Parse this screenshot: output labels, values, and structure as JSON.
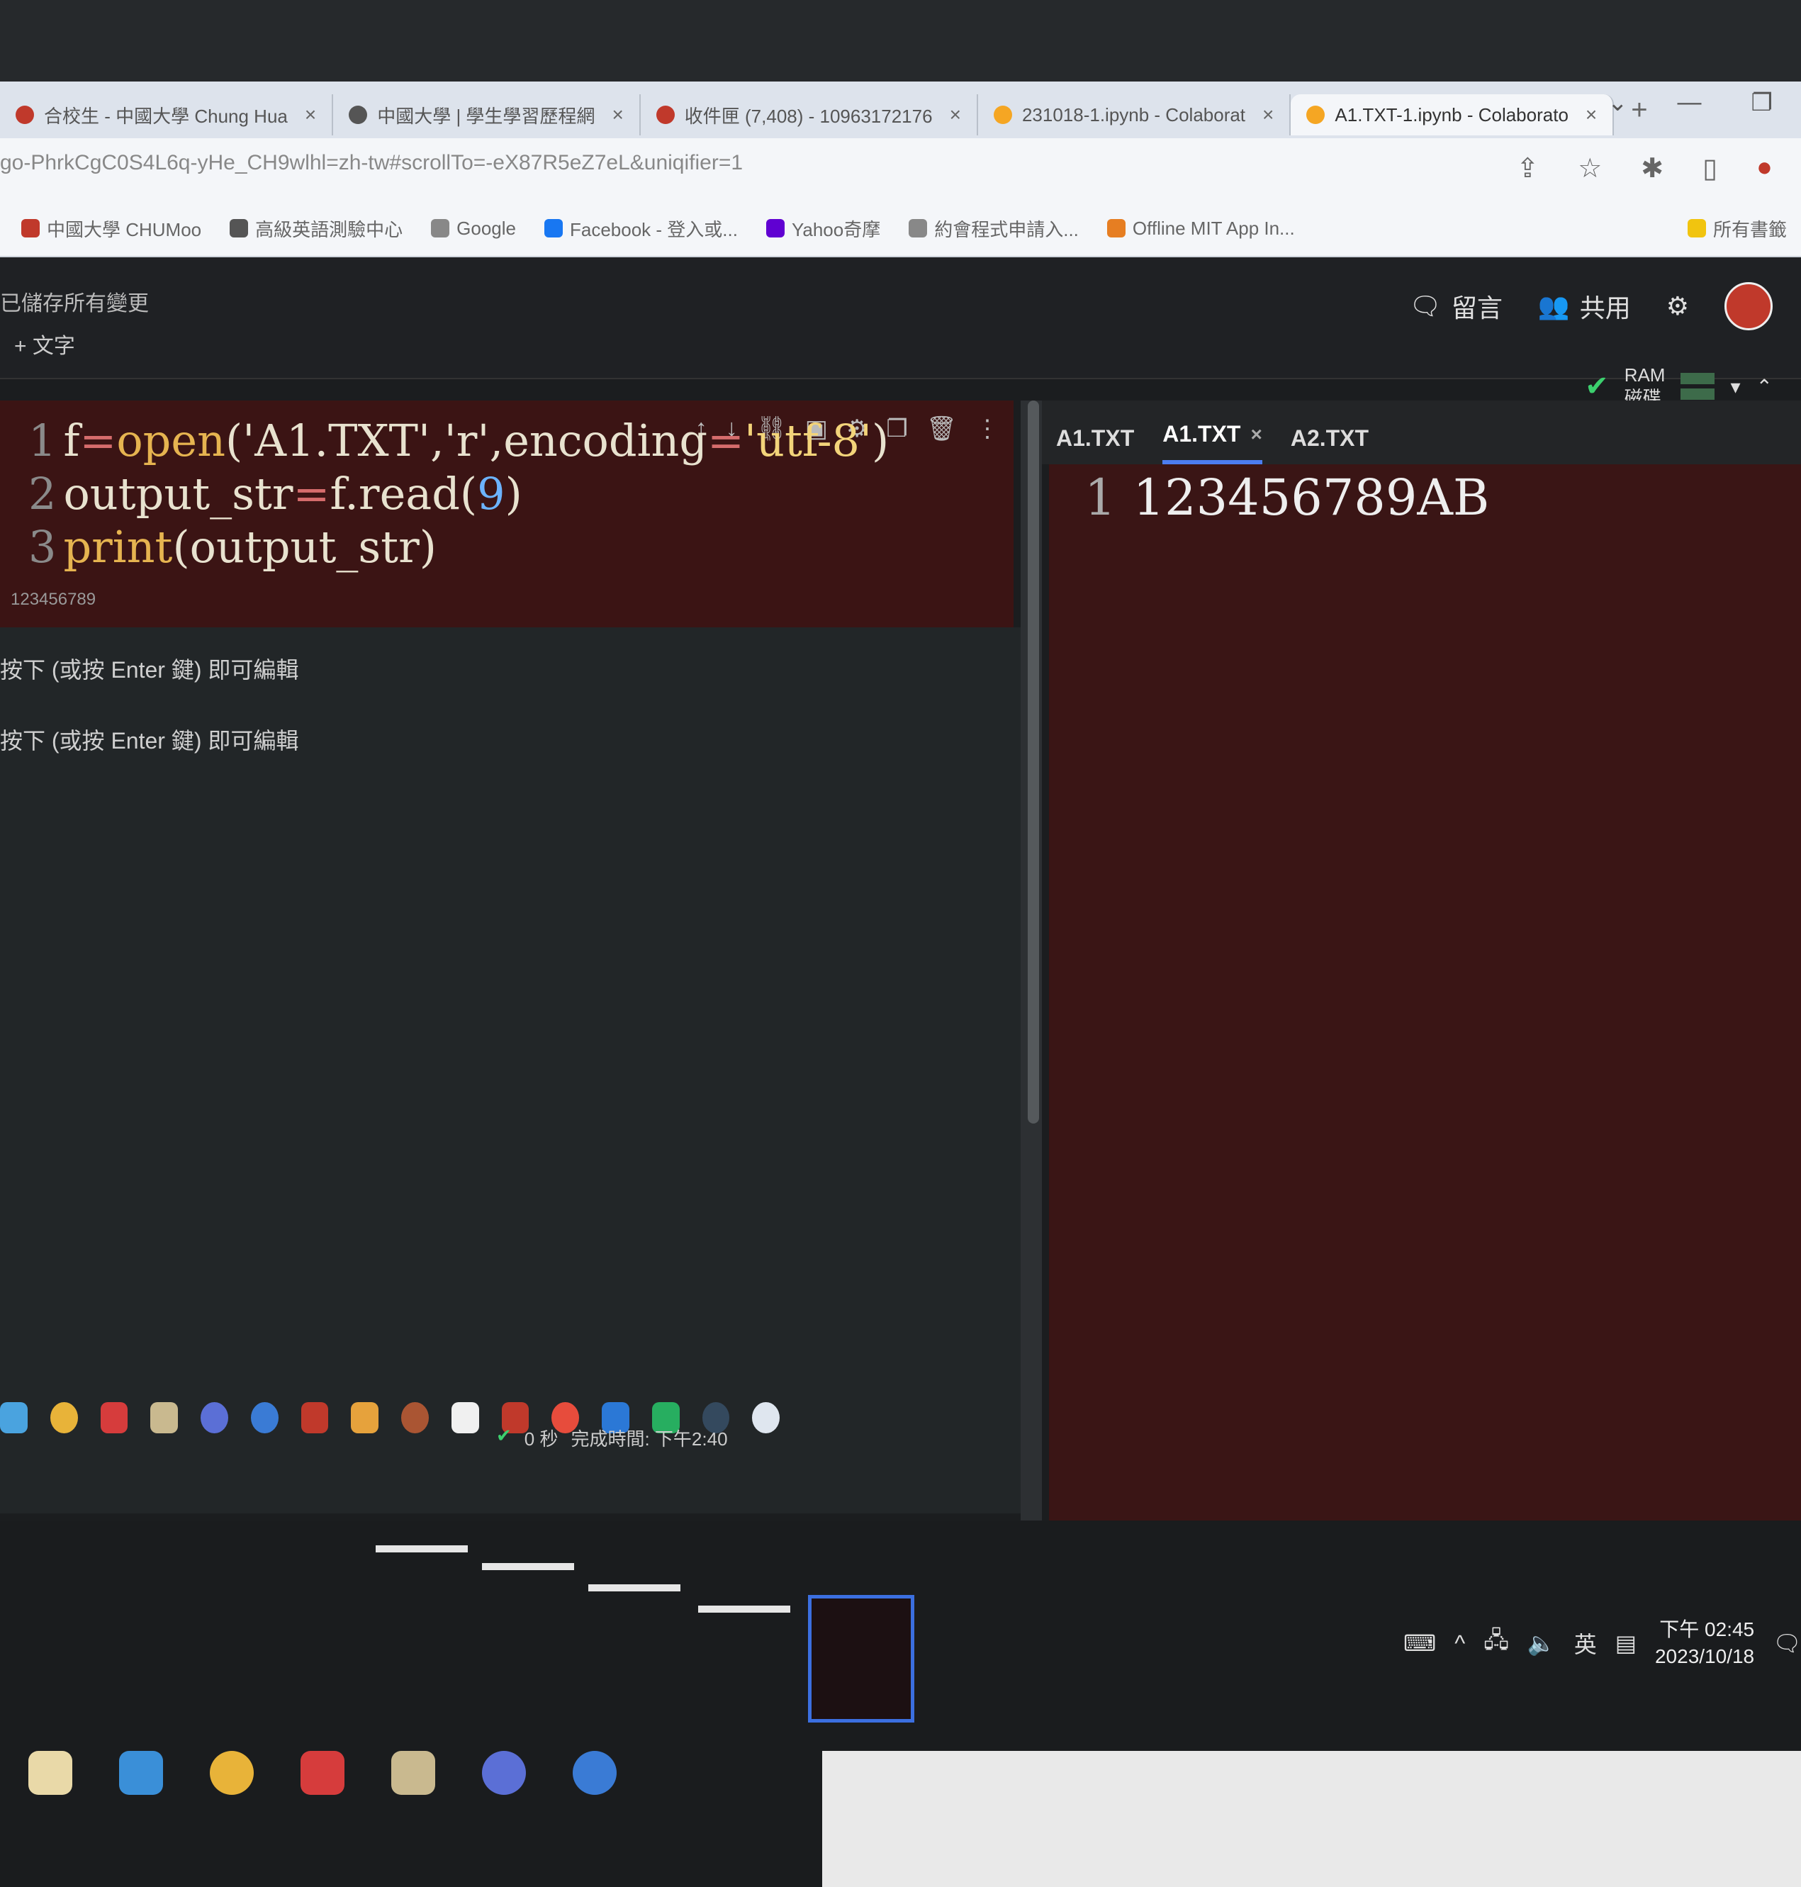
{
  "browser": {
    "tabs": [
      {
        "label": "合校生 - 中國大學 Chung Hua",
        "fav_color": "#c0392b",
        "active": false
      },
      {
        "label": "中國大學 | 學生學習歷程網",
        "fav_color": "#555555",
        "active": false
      },
      {
        "label": "收件匣 (7,408) - 10963172176",
        "fav_color": "#c0392b",
        "active": false
      },
      {
        "label": "231018-1.ipynb - Colaborat",
        "fav_color": "#f5a623",
        "active": false
      },
      {
        "label": "A1.TXT-1.ipynb - Colaborato",
        "fav_color": "#f5a623",
        "active": true
      }
    ],
    "new_tab": "+",
    "url": "go-PhrkCgC0S4L6q-yHe_CH9wlhl=zh-tw#scrollTo=-eX87R5eZ7eL&uniqifier=1",
    "bookmarks": [
      {
        "label": "中國大學 CHUMoo",
        "color": "#c0392b"
      },
      {
        "label": "高級英語測驗中心",
        "color": "#555555"
      },
      {
        "label": "Google",
        "color": "#888888"
      },
      {
        "label": "Facebook - 登入或...",
        "color": "#1877f2"
      },
      {
        "label": "Yahoo奇摩",
        "color": "#6001d2"
      },
      {
        "label": "約會程式申請入...",
        "color": "#888888"
      },
      {
        "label": "Offline MIT App In...",
        "color": "#e67e22"
      },
      {
        "label": "所有書籤",
        "color": "#f1c40f"
      }
    ]
  },
  "colab": {
    "save_status": "已儲存所有變更",
    "add_text": "+ 文字",
    "comment_label": "留言",
    "share_label": "共用",
    "ram_label": "RAM",
    "disk_label": "磁碟",
    "code_lines": [
      {
        "num": "1",
        "parts": [
          [
            "f",
            ""
          ],
          [
            "=",
            "op"
          ],
          [
            "open",
            "kw"
          ],
          [
            "('A1.TXT','r',encoding",
            ""
          ],
          [
            "=",
            "op"
          ],
          [
            "'utf-8'",
            "str"
          ],
          [
            ")",
            ""
          ]
        ]
      },
      {
        "num": "2",
        "parts": [
          [
            "output_str",
            ""
          ],
          [
            "=",
            "op"
          ],
          [
            "f.read(",
            ""
          ],
          [
            "9",
            "num"
          ],
          [
            ")",
            ""
          ]
        ]
      },
      {
        "num": "3",
        "parts": [
          [
            "print",
            "kw"
          ],
          [
            "(output_str)",
            ""
          ]
        ]
      }
    ],
    "cell_output": "123456789",
    "hints": [
      "按下 (或按 Enter 鍵) 即可編輯",
      "按下 (或按 Enter 鍵) 即可編輯"
    ]
  },
  "files": {
    "tabs": [
      {
        "label": "A1.TXT",
        "active": false
      },
      {
        "label": "A1.TXT",
        "active": true
      },
      {
        "label": "A2.TXT",
        "active": false
      }
    ],
    "line_num": "1",
    "content": "123456789AB"
  },
  "taskbar": {
    "status_time": "0 秒",
    "completed": "完成時間: 下午2:40",
    "clock_time": "下午 02:45",
    "clock_date": "2023/10/18",
    "lang": "英"
  }
}
